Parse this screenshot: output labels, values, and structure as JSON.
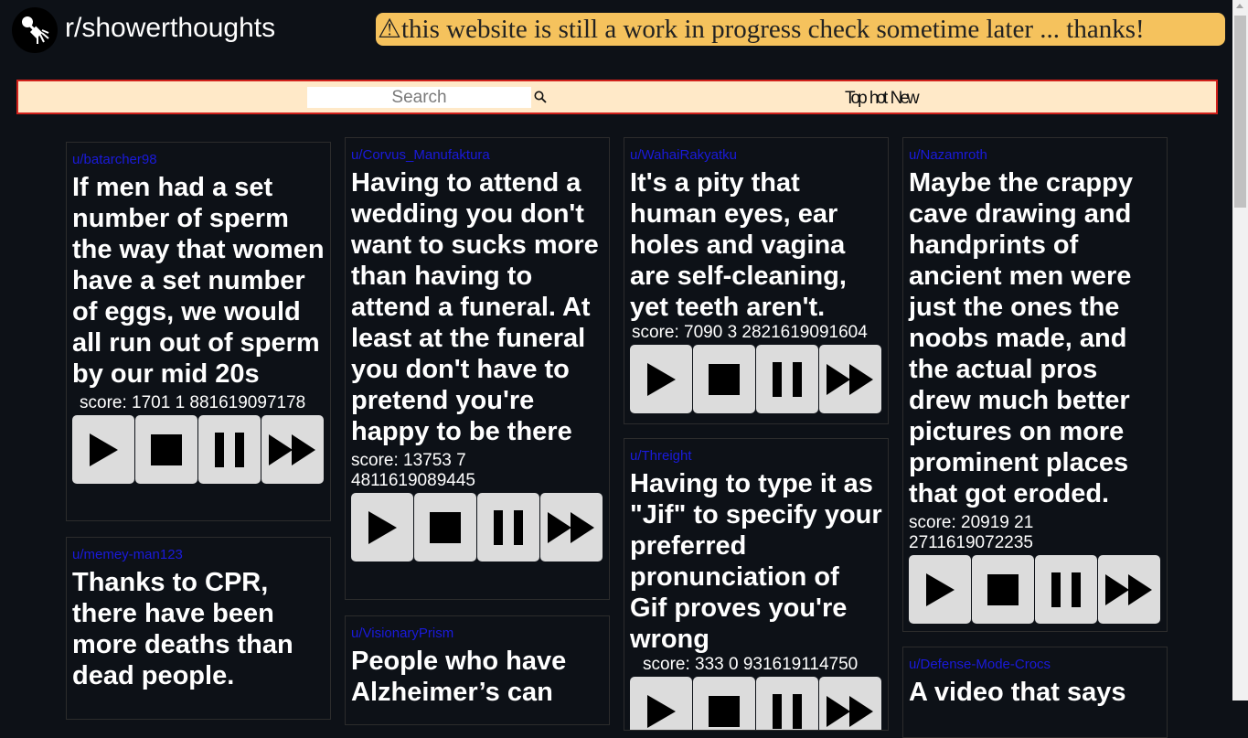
{
  "header": {
    "logo_icon": "skeleton-hand-logo",
    "title": "r/showerthoughts",
    "banner": "⚠this website is still a work in progress check sometime later ... thanks!"
  },
  "search": {
    "placeholder": "Search",
    "search_icon": "magnifier-icon",
    "sort_tabs": [
      "Top",
      "hot",
      "New"
    ]
  },
  "cards": [
    {
      "author": "u/batarcher98",
      "text": "If men had a set number of sperm the way that women have a set number of eggs, we would all run out of sperm by our mid 20s",
      "score": "score: 1701 1 881619097178"
    },
    {
      "author": "u/Corvus_Manufaktura",
      "text": "Having to attend a wedding you don't want to sucks more than having to attend a funeral. At least at the funeral you don't have to pretend you're happy to be there",
      "score": "score: 13753 7 4811619089445"
    },
    {
      "author": "u/WahaiRakyatku",
      "text": "It's a pity that human eyes, ear holes and vagina are self-cleaning, yet teeth aren't.",
      "score": "score: 7090 3 2821619091604"
    },
    {
      "author": "u/Nazamroth",
      "text": "Maybe the crappy cave drawing and handprints of ancient men were just the ones the noobs made, and the actual pros drew much better pictures on more prominent places that got eroded.",
      "score": "score: 20919 21 2711619072235"
    },
    {
      "author": "u/memey-man123",
      "text": "Thanks to CPR, there have been more deaths than dead people.",
      "score": ""
    },
    {
      "author": "u/VisionaryPrism",
      "text": "People who have Alzheimer’s can",
      "score": ""
    },
    {
      "author": "u/Threight",
      "text": "Having to type it as \"Jif\" to specify your preferred pronunciation of Gif proves you're wrong",
      "score": "score: 333 0 931619114750"
    },
    {
      "author": "u/Defense-Mode-Crocs",
      "text": "A video that says",
      "score": ""
    }
  ],
  "controls": {
    "play_icon": "play-icon",
    "stop_icon": "stop-icon",
    "pause_icon": "pause-icon",
    "fast_forward_icon": "fast-forward-icon"
  }
}
